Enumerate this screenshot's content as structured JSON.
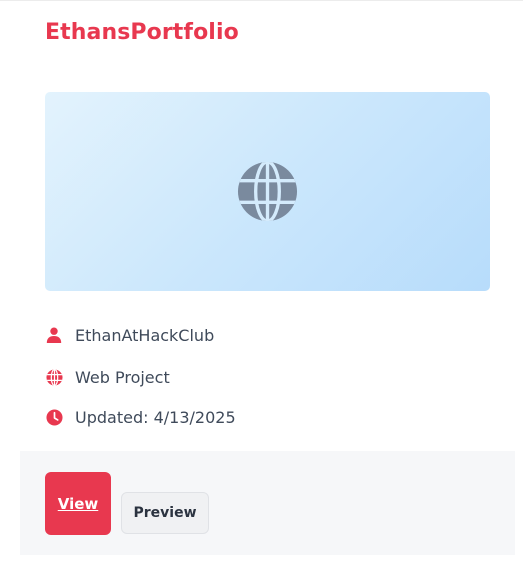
{
  "project": {
    "title": "EthansPortfolio",
    "thumbnail_icon": "globe-icon"
  },
  "meta": {
    "author": "EthanAtHackClub",
    "type": "Web Project",
    "updated": "Updated: 4/13/2025"
  },
  "actions": {
    "view_label": "View",
    "preview_label": "Preview"
  },
  "colors": {
    "accent": "#e8384f",
    "thumbnail_icon": "#7a8a9e",
    "text": "#3f4a5a",
    "footer_bg": "#f6f7f9"
  }
}
